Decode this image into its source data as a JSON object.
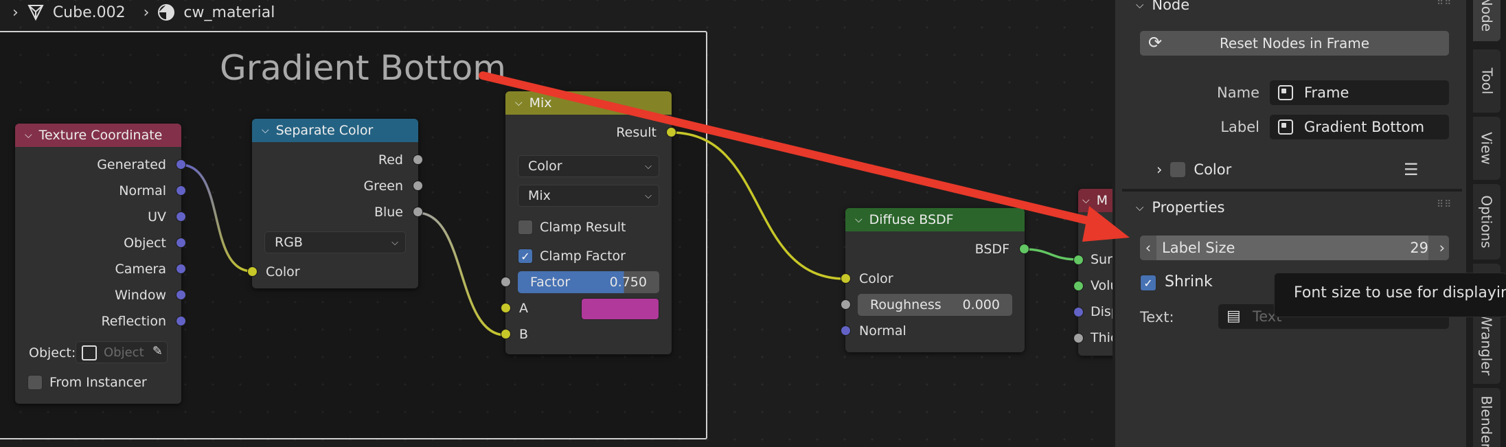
{
  "breadcrumb": {
    "object": "Cube.002",
    "material": "cw_material"
  },
  "frame": {
    "label": "Gradient Bottom"
  },
  "texture_coordinate": {
    "title": "Texture Coordinate",
    "outputs": [
      "Generated",
      "Normal",
      "UV",
      "Object",
      "Camera",
      "Window",
      "Reflection"
    ],
    "object_label": "Object:",
    "object_placeholder": "Object",
    "from_instancer": "From Instancer"
  },
  "separate_color": {
    "title": "Separate Color",
    "outputs": [
      "Red",
      "Green",
      "Blue"
    ],
    "mode": "RGB",
    "input": "Color"
  },
  "mix": {
    "title": "Mix",
    "output": "Result",
    "data_type": "Color",
    "blend_mode": "Mix",
    "clamp_result": "Clamp Result",
    "clamp_factor": "Clamp Factor",
    "factor_label": "Factor",
    "factor_value": "0.750",
    "input_a": "A",
    "input_b": "B",
    "color_a": "#b0399b"
  },
  "diffuse": {
    "title": "Diffuse BSDF",
    "output": "BSDF",
    "input_color": "Color",
    "roughness_label": "Roughness",
    "roughness_value": "0.000",
    "input_normal": "Normal"
  },
  "output_node": {
    "title_partial": "M",
    "inputs": [
      "Sur",
      "Volu",
      "Disp",
      "Thic"
    ]
  },
  "panel": {
    "node_section": "Node",
    "reset_button": "Reset Nodes in Frame",
    "name_label": "Name",
    "name_value": "Frame",
    "label_label": "Label",
    "label_value": "Gradient Bottom",
    "color_label": "Color",
    "properties_section": "Properties",
    "label_size_label": "Label Size",
    "label_size_value": "29",
    "shrink_label": "Shrink",
    "text_label": "Text:",
    "text_placeholder": "Text"
  },
  "tooltip": "Font size to use for displaying the label",
  "tabs": [
    "Node",
    "Tool",
    "View",
    "Options",
    "Node Wrangler",
    "Blender"
  ],
  "colors": {
    "header_texture": "#83314a",
    "header_separate": "#246283",
    "header_mix": "#848426",
    "header_shader": "#2b652b",
    "annotation_arrow": "#e8392a"
  }
}
